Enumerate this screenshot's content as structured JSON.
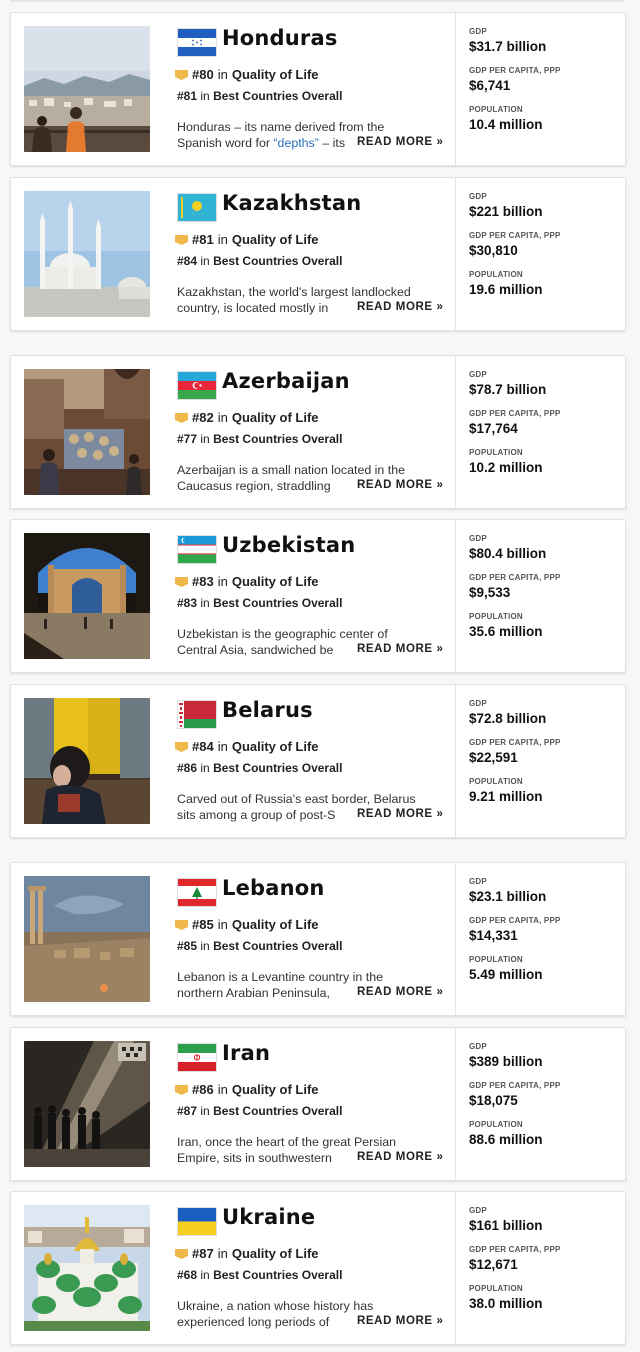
{
  "labels": {
    "rank_in": "in",
    "qol_category": "Quality of Life",
    "overall_category": "Best Countries Overall",
    "read_more": "READ MORE »",
    "gdp": "GDP",
    "gdp_per_capita": "GDP PER CAPITA, PPP",
    "population": "POPULATION"
  },
  "icons": {
    "medal": "medal-icon",
    "photo": "country-photo"
  },
  "colors": {
    "link": "#2a6ebb",
    "medal": "#f0b84a"
  },
  "countries": [
    {
      "name": "Honduras",
      "qol_rank": "#80",
      "overall_rank": "#81",
      "desc_line1": "Honduras – its name derived from the",
      "desc_line2": "Spanish word for ",
      "desc_link": "“depths”",
      "desc_rest": " – its",
      "gdp": "$31.7 billion",
      "gdp_pc": "$6,741",
      "population": "10.4 million"
    },
    {
      "name": "Kazakhstan",
      "qol_rank": "#81",
      "overall_rank": "#84",
      "desc_line1": "Kazakhstan, the world's largest landlocked",
      "desc_line2": "country, is located mostly in",
      "gdp": "$221 billion",
      "gdp_pc": "$30,810",
      "population": "19.6 million"
    },
    {
      "name": "Azerbaijan",
      "qol_rank": "#82",
      "overall_rank": "#77",
      "desc_line1": "Azerbaijan is a small nation located in the",
      "desc_line2": "Caucasus region, straddling",
      "gdp": "$78.7 billion",
      "gdp_pc": "$17,764",
      "population": "10.2 million"
    },
    {
      "name": "Uzbekistan",
      "qol_rank": "#83",
      "overall_rank": "#83",
      "desc_line1": "Uzbekistan is the geographic center of",
      "desc_line2": "Central Asia, sandwiched be",
      "gdp": "$80.4 billion",
      "gdp_pc": "$9,533",
      "population": "35.6 million"
    },
    {
      "name": "Belarus",
      "qol_rank": "#84",
      "overall_rank": "#86",
      "desc_line1": "Carved out of Russia's east border, Belarus",
      "desc_line2": "sits among a group of post-S",
      "gdp": "$72.8 billion",
      "gdp_pc": "$22,591",
      "population": "9.21 million"
    },
    {
      "name": "Lebanon",
      "qol_rank": "#85",
      "overall_rank": "#85",
      "desc_line1": "Lebanon is a Levantine country in the",
      "desc_line2": "northern Arabian Peninsula,",
      "gdp": "$23.1 billion",
      "gdp_pc": "$14,331",
      "population": "5.49 million"
    },
    {
      "name": "Iran",
      "qol_rank": "#86",
      "overall_rank": "#87",
      "desc_line1": "Iran, once the heart of the great Persian",
      "desc_line2": "Empire, sits in southwestern",
      "gdp": "$389 billion",
      "gdp_pc": "$18,075",
      "population": "88.6 million"
    },
    {
      "name": "Ukraine",
      "qol_rank": "#87",
      "overall_rank": "#68",
      "desc_line1": "Ukraine, a nation whose history has",
      "desc_line2": "experienced long periods of",
      "gdp": "$161 billion",
      "gdp_pc": "$12,671",
      "population": "38.0 million"
    }
  ]
}
